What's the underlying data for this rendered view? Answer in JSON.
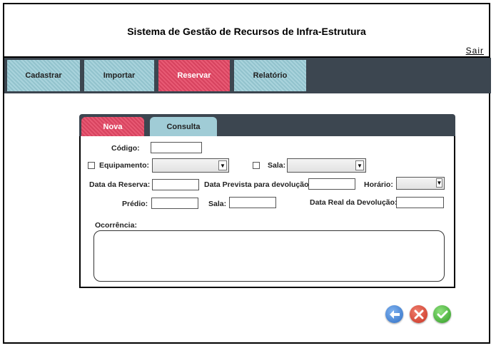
{
  "app": {
    "title": "Sistema de Gestão de Recursos de Infra-Estrutura",
    "logout_label": "Sair"
  },
  "nav": {
    "items": [
      {
        "label": "Cadastrar",
        "active": false
      },
      {
        "label": "Importar",
        "active": false
      },
      {
        "label": "Reservar",
        "active": true
      },
      {
        "label": "Relatório",
        "active": false
      }
    ]
  },
  "tabs": [
    {
      "label": "Nova",
      "active": true
    },
    {
      "label": "Consulta",
      "active": false
    }
  ],
  "form": {
    "codigo_label": "Código:",
    "codigo_value": "",
    "equipamento_label": "Equipamento:",
    "equipamento_checked": false,
    "equipamento_value": "",
    "sala_select_label": "Sala:",
    "sala_select_checked": false,
    "sala_select_value": "",
    "data_reserva_label": "Data da Reserva:",
    "data_reserva_value": "",
    "data_prevista_label": "Data Prevista para devolução:",
    "data_prevista_value": "",
    "horario_label": "Horário:",
    "horario_value": "",
    "predio_label": "Prédio:",
    "predio_value": "",
    "sala_label": "Sala:",
    "sala_value": "",
    "data_real_label": "Data Real da Devolução:",
    "data_real_value": "",
    "ocorrencia_label": "Ocorrência:",
    "ocorrencia_value": ""
  },
  "actions": [
    {
      "icon": "back-arrow-icon",
      "color": "#2f6fc4"
    },
    {
      "icon": "cancel-x-icon",
      "color": "#d23a2a"
    },
    {
      "icon": "confirm-check-icon",
      "color": "#3aa52a"
    }
  ],
  "colors": {
    "nav_bg": "#3c4650",
    "active_tab": "#e04f6b",
    "inactive_tab": "#a0ccd6"
  }
}
